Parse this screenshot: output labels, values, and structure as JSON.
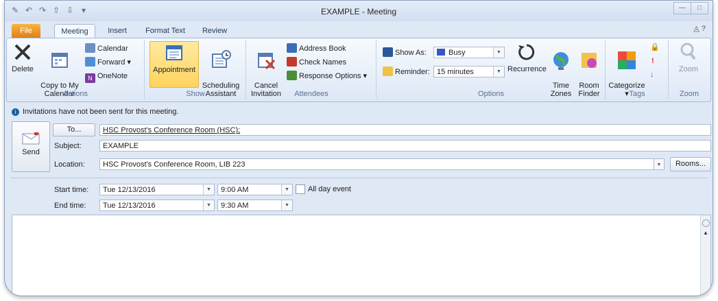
{
  "window": {
    "title": "EXAMPLE  -  Meeting"
  },
  "tabs": [
    "File",
    "Meeting",
    "Insert",
    "Format Text",
    "Review"
  ],
  "ribbon": {
    "actions": {
      "label": "Actions",
      "delete": "Delete",
      "copy_to_my_calendar": "Copy to My\nCalendar",
      "calendar": "Calendar",
      "forward": "Forward ▾",
      "onenote": "OneNote"
    },
    "show": {
      "label": "Show",
      "appointment": "Appointment",
      "scheduling_assistant": "Scheduling\nAssistant"
    },
    "attendees": {
      "label": "Attendees",
      "cancel_invitation": "Cancel\nInvitation",
      "address_book": "Address Book",
      "check_names": "Check Names",
      "response_options": "Response Options ▾"
    },
    "options": {
      "label": "Options",
      "show_as_label": "Show As:",
      "show_as_value": "Busy",
      "reminder_label": "Reminder:",
      "reminder_value": "15 minutes",
      "recurrence": "Recurrence",
      "time_zones": "Time\nZones",
      "room_finder": "Room\nFinder"
    },
    "tags": {
      "label": "Tags",
      "categorize": "Categorize\n▾"
    },
    "zoom": {
      "label": "Zoom",
      "zoom_button": "Zoom"
    }
  },
  "info_message": "Invitations have not been sent for this meeting.",
  "form": {
    "send_label": "Send",
    "to_button": "To...",
    "to_value": "HSC Provost's Conference Room (HSC);",
    "subject_label": "Subject:",
    "subject_value": "EXAMPLE",
    "location_label": "Location:",
    "location_value": "HSC Provost's Conference Room, LIB 223",
    "rooms_button": "Rooms...",
    "start_label": "Start time:",
    "start_date": "Tue 12/13/2016",
    "start_time": "9:00 AM",
    "all_day_label": "All day event",
    "end_label": "End time:",
    "end_date": "Tue 12/13/2016",
    "end_time": "9:30 AM"
  },
  "colors": {
    "accent": "#2b579a",
    "file_tab": "#e88a22",
    "busy": "#3a56c4"
  }
}
